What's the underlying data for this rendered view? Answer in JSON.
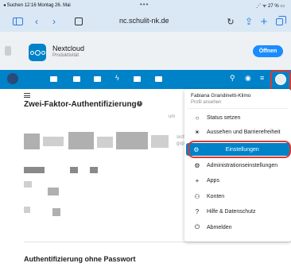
{
  "status_bar": {
    "left": "◂ Suchen  12:16  Montag 26. Mai",
    "dots": "•••",
    "right": "⋰ ᯤ 27 % ▭"
  },
  "browser": {
    "url": "nc.schulit-nk.de",
    "back_icon": "‹",
    "forward_icon": "›",
    "reload_icon": "↻",
    "share_icon": "⇪",
    "plus_icon": "+"
  },
  "app_banner": {
    "name": "Nextcloud",
    "subtitle": "Produktivität",
    "open_label": "Öffnen"
  },
  "nc_header": {
    "bolt_icon": "ϟ",
    "search_icon": "⚲",
    "bell_icon": "◉",
    "contacts_icon": "≡"
  },
  "page": {
    "title": "Zwei-Faktor-Authentifizierung",
    "info_icon": "i",
    "truncated_1": "um",
    "truncated_2": "sich",
    "truncated_3": "gsp",
    "section2_title": "Authentifizierung ohne Passwort"
  },
  "user_menu": {
    "name": "Fabiana Grandinetti-Klimo",
    "profile": "Profil ansehen",
    "items": [
      {
        "label": "Status setzen",
        "icon": "○"
      },
      {
        "label": "Aussehen und Barrierefreiheit",
        "icon": "☀"
      },
      {
        "label": "Einstellungen",
        "icon": "⚙"
      },
      {
        "label": "Administrationseinstellungen",
        "icon": "⚙"
      },
      {
        "label": "Apps",
        "icon": "+"
      },
      {
        "label": "Konten",
        "icon": "⚇"
      },
      {
        "label": "Hilfe & Datenschutz",
        "icon": "?"
      },
      {
        "label": "Abmelden",
        "icon": "⏻"
      }
    ]
  },
  "colors": {
    "brand": "#0082c9",
    "highlight": "#d93b2e",
    "open_button": "#1a8cff"
  }
}
